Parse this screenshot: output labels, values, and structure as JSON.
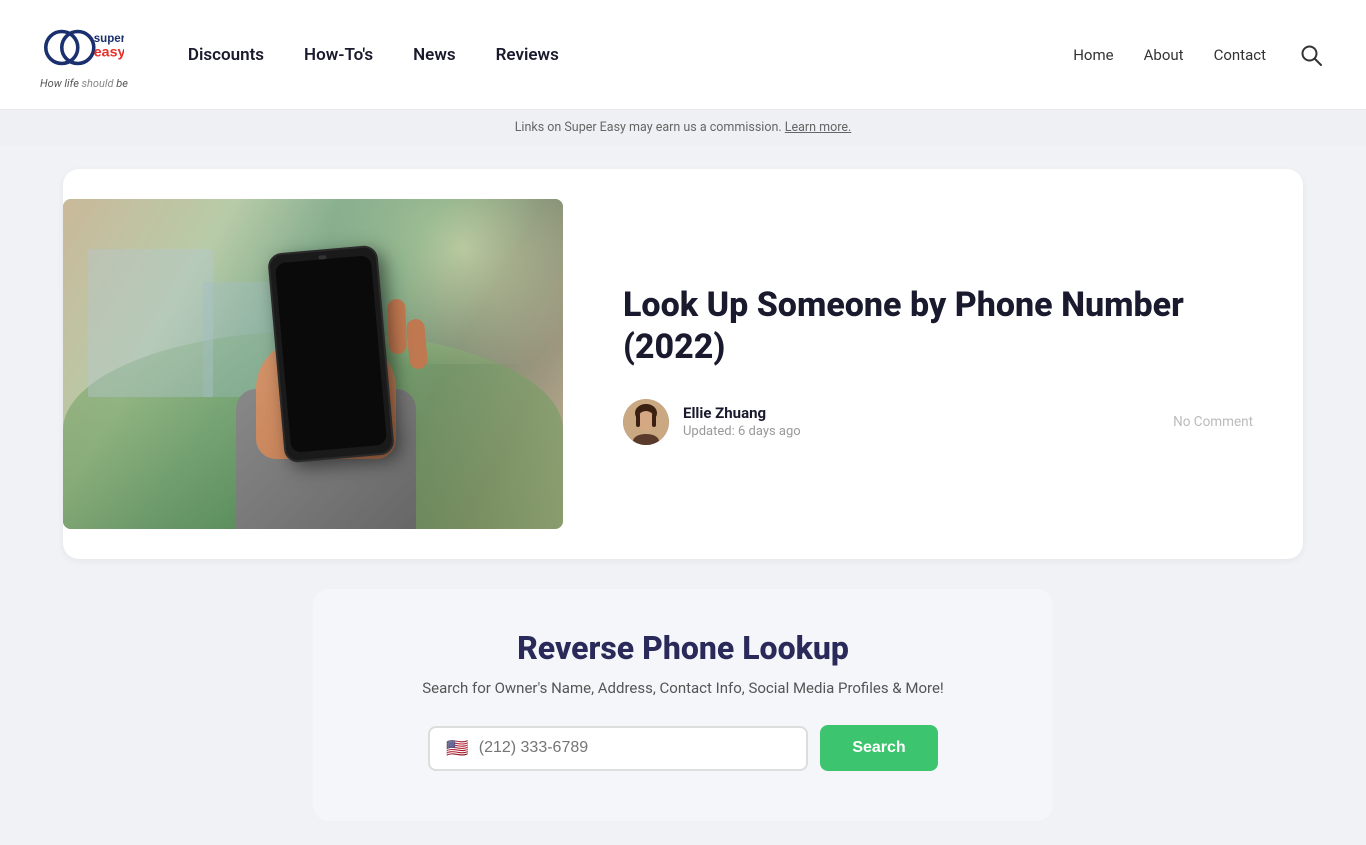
{
  "header": {
    "logo_tagline_prefix": "How life ",
    "logo_tagline_bold": "should",
    "logo_tagline_suffix": " be",
    "nav": [
      {
        "label": "Discounts",
        "id": "discounts"
      },
      {
        "label": "How-To's",
        "id": "howtos"
      },
      {
        "label": "News",
        "id": "news"
      },
      {
        "label": "Reviews",
        "id": "reviews"
      }
    ],
    "nav_right": [
      {
        "label": "Home",
        "id": "home"
      },
      {
        "label": "About",
        "id": "about"
      },
      {
        "label": "Contact",
        "id": "contact"
      }
    ]
  },
  "disclaimer": {
    "text": "Links on Super Easy may earn us a commission.",
    "link_text": "Learn more."
  },
  "article": {
    "title": "Look Up Someone by Phone Number (2022)",
    "author_name": "Ellie Zhuang",
    "updated": "Updated: 6 days ago",
    "no_comment": "No Comment"
  },
  "widget": {
    "title": "Reverse Phone Lookup",
    "subtitle": "Search for Owner's Name, Address, Contact Info, Social Media Profiles & More!",
    "input_placeholder": "(212) 333-6789",
    "search_button": "Search",
    "flag": "🇺🇸"
  }
}
